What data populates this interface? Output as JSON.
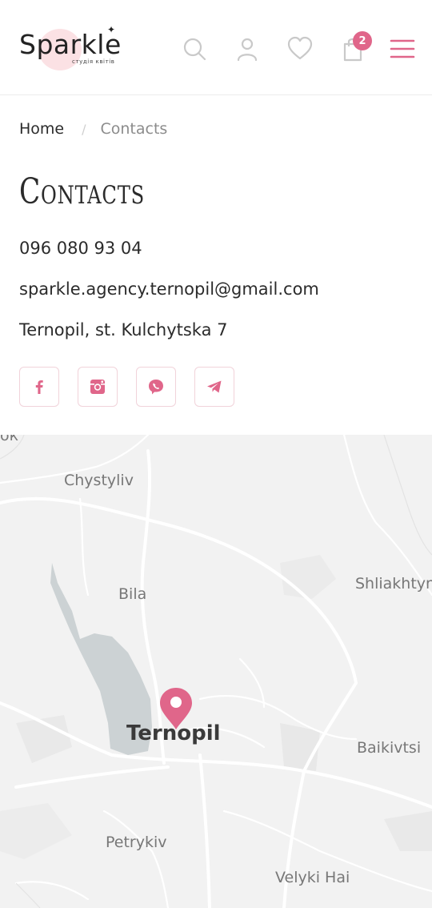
{
  "header": {
    "logo_text": "Sparkle",
    "logo_subtitle": "студія квітів",
    "cart_count": "2",
    "icons": [
      "search-icon",
      "user-icon",
      "heart-icon",
      "cart-icon",
      "menu-icon"
    ],
    "accent_color": "#e0668a"
  },
  "breadcrumb": {
    "home": "Home",
    "separator": "/",
    "current": "Contacts"
  },
  "page": {
    "title": "Contacts",
    "phone": "096 080 93 04",
    "email": "sparkle.agency.ternopil@gmail.com",
    "address": "Ternopil, st. Kulchytska 7"
  },
  "social": [
    "facebook-icon",
    "instagram-icon",
    "viber-icon",
    "telegram-icon"
  ],
  "map": {
    "labels": {
      "top_cut": "ок",
      "chystyliv": "Chystyliv",
      "bila": "Bila",
      "shliakhtyn": "Shliakhtyn",
      "baikivtsi": "Baikivtsi",
      "petrykiv": "Petrykiv",
      "velyki_hai": "Velyki Hai"
    },
    "city": "Ternopil"
  }
}
